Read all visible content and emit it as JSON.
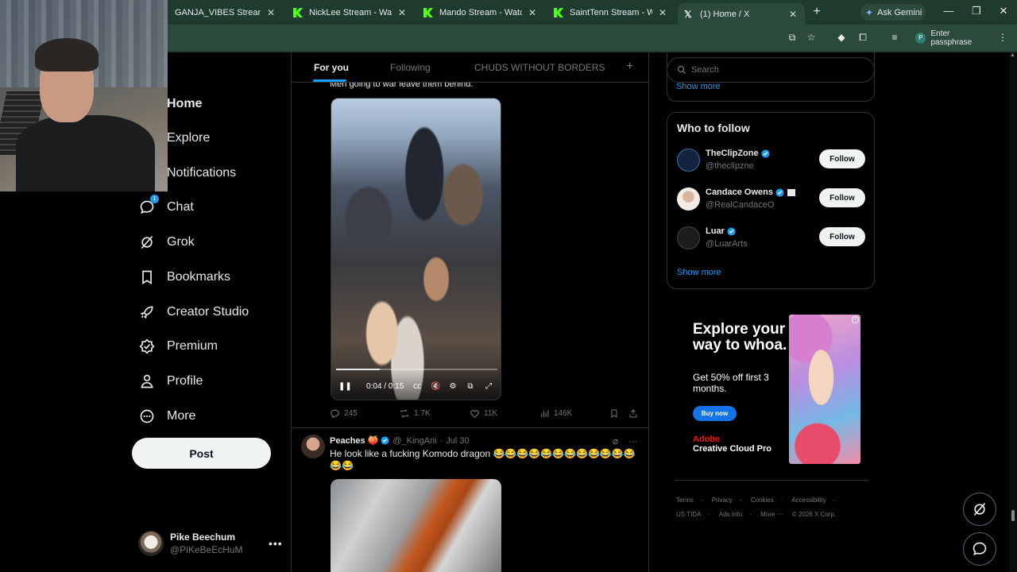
{
  "browser": {
    "tabs": [
      {
        "title": "GANJA_VIBES Stream - Watc",
        "favicon": "kick-icon"
      },
      {
        "title": "NickLee Stream - Watch Live",
        "favicon": "kick-icon"
      },
      {
        "title": "Mando Stream - Watch Live",
        "favicon": "kick-icon"
      },
      {
        "title": "SaintTenn Stream - Watch Li",
        "favicon": "kick-icon"
      },
      {
        "title": "(1) Home / X",
        "favicon": "x-icon",
        "active": true
      }
    ],
    "ask_gemini": "Ask Gemini",
    "profile_chip": "Enter passphrase",
    "profile_initial": "P"
  },
  "nav": {
    "items": [
      {
        "label": "Home",
        "icon": "home-icon",
        "active": true
      },
      {
        "label": "Explore",
        "icon": "search-icon"
      },
      {
        "label": "Notifications",
        "icon": "bell-icon"
      },
      {
        "label": "Chat",
        "icon": "chat-icon",
        "badge": "1"
      },
      {
        "label": "Grok",
        "icon": "grok-icon"
      },
      {
        "label": "Bookmarks",
        "icon": "bookmark-icon"
      },
      {
        "label": "Creator Studio",
        "icon": "rocket-icon"
      },
      {
        "label": "Premium",
        "icon": "premium-icon"
      },
      {
        "label": "Profile",
        "icon": "person-icon"
      },
      {
        "label": "More",
        "icon": "more-icon"
      }
    ],
    "post_label": "Post"
  },
  "account": {
    "name": "Pike Beechum",
    "handle": "@PiKeBeEcHuM"
  },
  "feed": {
    "tabs": [
      "For you",
      "Following",
      "CHUDS WITHOUT BORDERS"
    ],
    "active_tab": "For you",
    "tweet1": {
      "text_tail": "Men going to war leave them behind.",
      "video_time": "0:04 / 0:15",
      "video_progress": 0.27,
      "replies": "245",
      "reposts": "1.7K",
      "likes": "11K",
      "views": "146K"
    },
    "tweet2": {
      "name": "Peaches",
      "name_emoji": "🍑",
      "handle": "@_KingArii",
      "date": "Jul 30",
      "text": "He look like a fucking Komodo dragon 😂😂😂😂😂😂😂😂😂😂😂😂😂😂"
    }
  },
  "sidebar": {
    "search_placeholder": "Search",
    "show_more_top": "Show more",
    "who_to_follow": {
      "title": "Who to follow",
      "users": [
        {
          "name": "TheClipZone",
          "handle": "@theclipzne",
          "follow": "Follow",
          "avatar_color": "#14243f"
        },
        {
          "name": "Candace Owens",
          "handle": "@RealCandaceO",
          "follow": "Follow",
          "avatar_color": "#e9d7c9"
        },
        {
          "name": "Luar",
          "handle": "@LuarArts",
          "follow": "Follow",
          "avatar_color": "#1c1c1c"
        }
      ],
      "show_more": "Show more"
    },
    "ad": {
      "headline": "Explore your way to whoa.",
      "sub": "Get 50% off first 3 months.",
      "button": "Buy now",
      "brand": "Adobe",
      "product": "Creative Cloud Pro"
    },
    "footer": [
      "Terms",
      "Privacy",
      "Cookies",
      "Accessibility",
      "US TIDA",
      "Ads Info",
      "More ···",
      "© 2026 X Corp."
    ]
  },
  "colors": {
    "accent": "#1d9bf0",
    "border": "#2f3336",
    "muted": "#71767b",
    "chrome_green": "#2c4a3c"
  }
}
